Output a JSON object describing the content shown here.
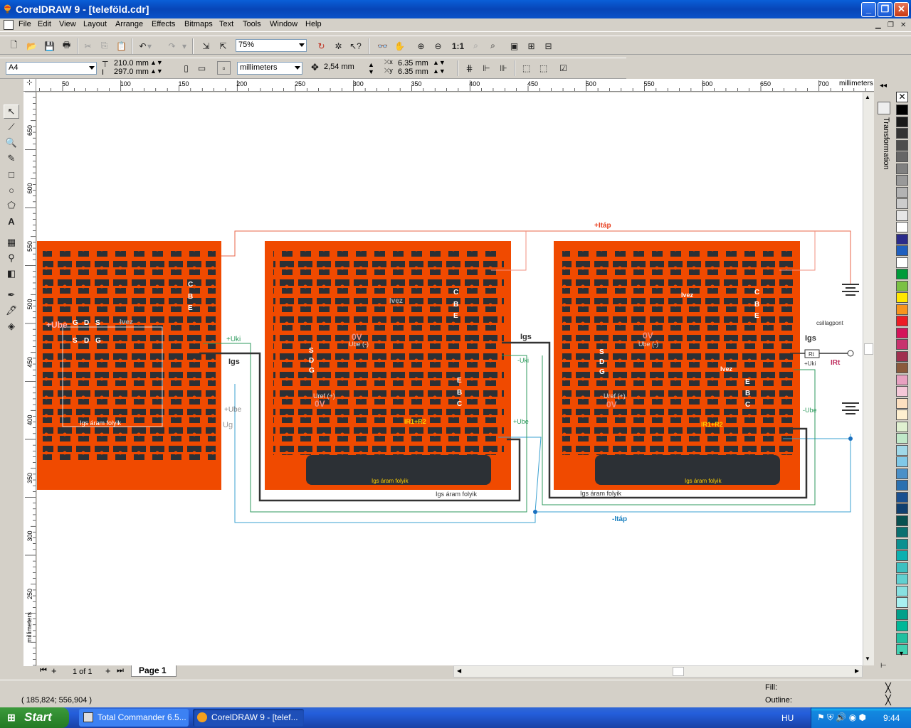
{
  "window": {
    "title": "CorelDRAW 9 - [teleföld.cdr]",
    "min": "_",
    "max": "❐",
    "close": "✕"
  },
  "menu": [
    "File",
    "Edit",
    "View",
    "Layout",
    "Arrange",
    "Effects",
    "Bitmaps",
    "Text",
    "Tools",
    "Window",
    "Help"
  ],
  "toolbar": {
    "zoom": "75%"
  },
  "property_bar": {
    "paper": "A4",
    "width": "210.0 mm",
    "height": "297.0 mm",
    "units": "millimeters",
    "nudge": "2,54 mm",
    "dup_x": "6.35 mm",
    "dup_y": "6.35 mm"
  },
  "ruler": {
    "h_ticks": [
      "50",
      "100",
      "150",
      "200",
      "250",
      "300",
      "350",
      "400",
      "450",
      "500",
      "550",
      "600",
      "650",
      "700"
    ],
    "h_units": "millimeters",
    "v_ticks": [
      "650",
      "600",
      "550",
      "500",
      "450",
      "400",
      "350",
      "300",
      "250"
    ],
    "v_units": "millimeters"
  },
  "page_nav": {
    "count": "1 of 1",
    "tab": "Page 1"
  },
  "docker": {
    "title": "Transformation"
  },
  "status": {
    "coords": "( 185,824; 556,904 )",
    "fill_label": "Fill:",
    "outline_label": "Outline:"
  },
  "taskbar": {
    "start": "Start",
    "tasks": [
      "Total Commander 6.5...",
      "CorelDRAW 9 - [telef..."
    ],
    "lang": "HU",
    "clock": "9:44"
  },
  "drawing": {
    "top_label": "+Itáp",
    "bottom_label": "-Itáp",
    "board1": {
      "ube": "+Ube",
      "sdg_top": [
        "G",
        "D",
        "S"
      ],
      "sdg_bot": [
        "S",
        "D",
        "G"
      ],
      "cbe": [
        "C",
        "B",
        "E"
      ],
      "ivez": "Ivez",
      "igs": "Igs",
      "uki": "+Uki",
      "ube2": "+Ube",
      "ug": "Ug",
      "folyik": "Igs áram folyik"
    },
    "board2": {
      "ivez": "Ivez",
      "ov1": "0V",
      "ube_minus": "Ube (-)",
      "cbe": [
        "C",
        "B",
        "E"
      ],
      "sdg": [
        "S",
        "D",
        "G"
      ],
      "ebc": [
        "E",
        "B",
        "C"
      ],
      "uref": "Uref (+)",
      "ov2": "0V",
      "ir": "IR1+R2",
      "folyik": "Igs áram folyik",
      "igs": "Igs",
      "uki": "-Uki",
      "ube": "+Ube",
      "folyik2": "Igs áram folyik"
    },
    "board3": {
      "ivez": "Ivez",
      "ov1": "0V",
      "ube_minus": "Ube (-)",
      "cbe": [
        "C",
        "B",
        "E"
      ],
      "sdg": [
        "S",
        "D",
        "G"
      ],
      "ebc": [
        "E",
        "B",
        "C"
      ],
      "ivez2": "Ivez",
      "uref": "Uref (+)",
      "ov2": "0V",
      "ir": "IR1+R2",
      "folyik": "Igs áram folyik",
      "igs": "Igs",
      "ube": "-Ube",
      "rt": "Rt",
      "uki": "+Uki",
      "irt": "IRt",
      "csillag": "csillagpont",
      "folyik2": "Igs áram folyik"
    }
  },
  "palette": [
    "#000000",
    "#1a1a1a",
    "#333333",
    "#4d4d4d",
    "#666666",
    "#808080",
    "#999999",
    "#b3b3b3",
    "#cccccc",
    "#e6e6e6",
    "#ffffff",
    "#2b2b8a",
    "#1f5fbf",
    "#ffffff",
    "#009b3a",
    "#7ac143",
    "#ffe600",
    "#f7941d",
    "#ed1c24",
    "#d4145a",
    "#c8326e",
    "#a0304f",
    "#8b5a3c",
    "#e8a0c0",
    "#f5c8d8",
    "#fde0c0",
    "#fff0d0",
    "#e0f0d0",
    "#c0e8c8",
    "#a0d8e8",
    "#80c8e8",
    "#4a90c8",
    "#2a70b0",
    "#1a5090",
    "#104070",
    "#085050",
    "#0a7070",
    "#0a9090",
    "#0ab0b0",
    "#3cc0c0",
    "#60d0d0",
    "#88e0e0",
    "#a8f0f0",
    "#00a08a",
    "#00b898",
    "#20c0a0",
    "#40d0b0"
  ]
}
